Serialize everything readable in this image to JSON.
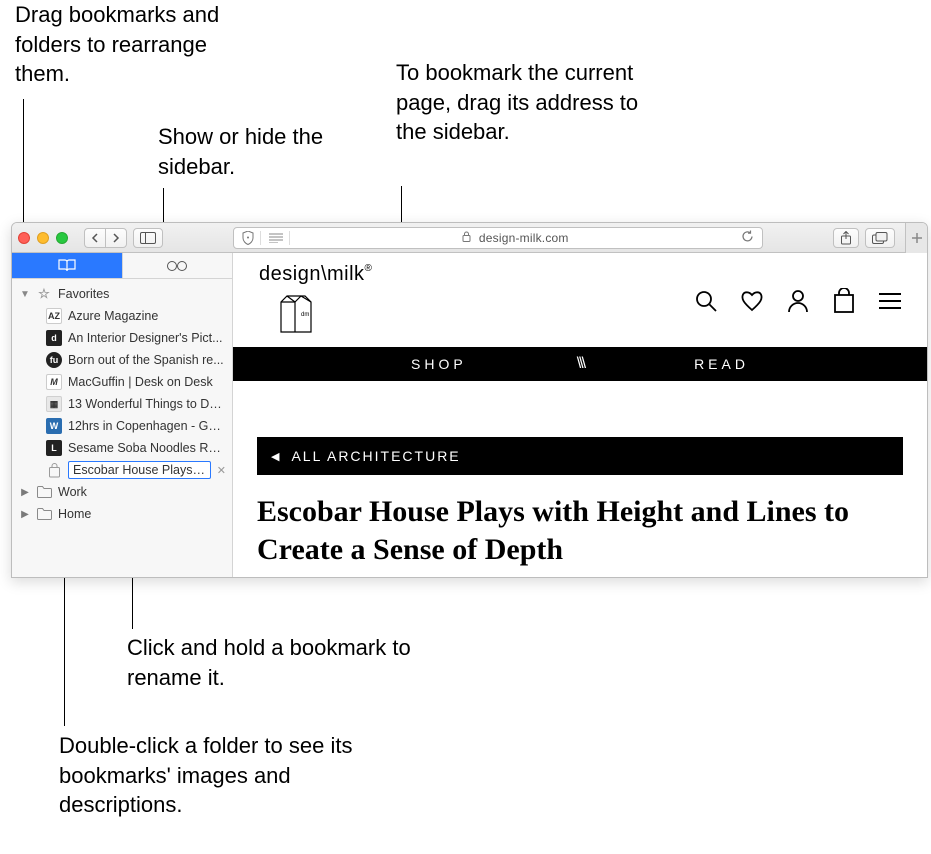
{
  "callouts": {
    "c1": "Drag bookmarks and folders to rearrange them.",
    "c2": "Show or hide the sidebar.",
    "c3": "To bookmark the current page, drag its address to the sidebar.",
    "c4": "Click and hold a bookmark to rename it.",
    "c5": "Double-click a folder to see its bookmarks' images and descriptions."
  },
  "toolbar": {
    "address": "design-milk.com"
  },
  "sidebar": {
    "favorites_label": "Favorites",
    "items": [
      {
        "label": "Azure Magazine",
        "icon": "AZ",
        "style": "w"
      },
      {
        "label": "An Interior Designer's Pict...",
        "icon": "d",
        "style": "dark"
      },
      {
        "label": "Born out of the Spanish re...",
        "icon": "●",
        "style": "w"
      },
      {
        "label": "MacGuffin | Desk on Desk",
        "icon": "M",
        "style": "w"
      },
      {
        "label": "13 Wonderful Things to Do...",
        "icon": "▦",
        "style": "grey"
      },
      {
        "label": "12hrs in Copenhagen - Gui...",
        "icon": "W",
        "style": "dark"
      },
      {
        "label": "Sesame Soba Noodles Rec...",
        "icon": "L",
        "style": "dark"
      }
    ],
    "editing_label": "Escobar House Plays with ",
    "folders": [
      {
        "label": "Work"
      },
      {
        "label": "Home"
      }
    ]
  },
  "page": {
    "brand": "design\\milk",
    "nav_shop": "SHOP",
    "nav_read": "READ",
    "arch": "ALL ARCHITECTURE",
    "headline": "Escobar House Plays with Height and Lines to Create a Sense of Depth"
  }
}
